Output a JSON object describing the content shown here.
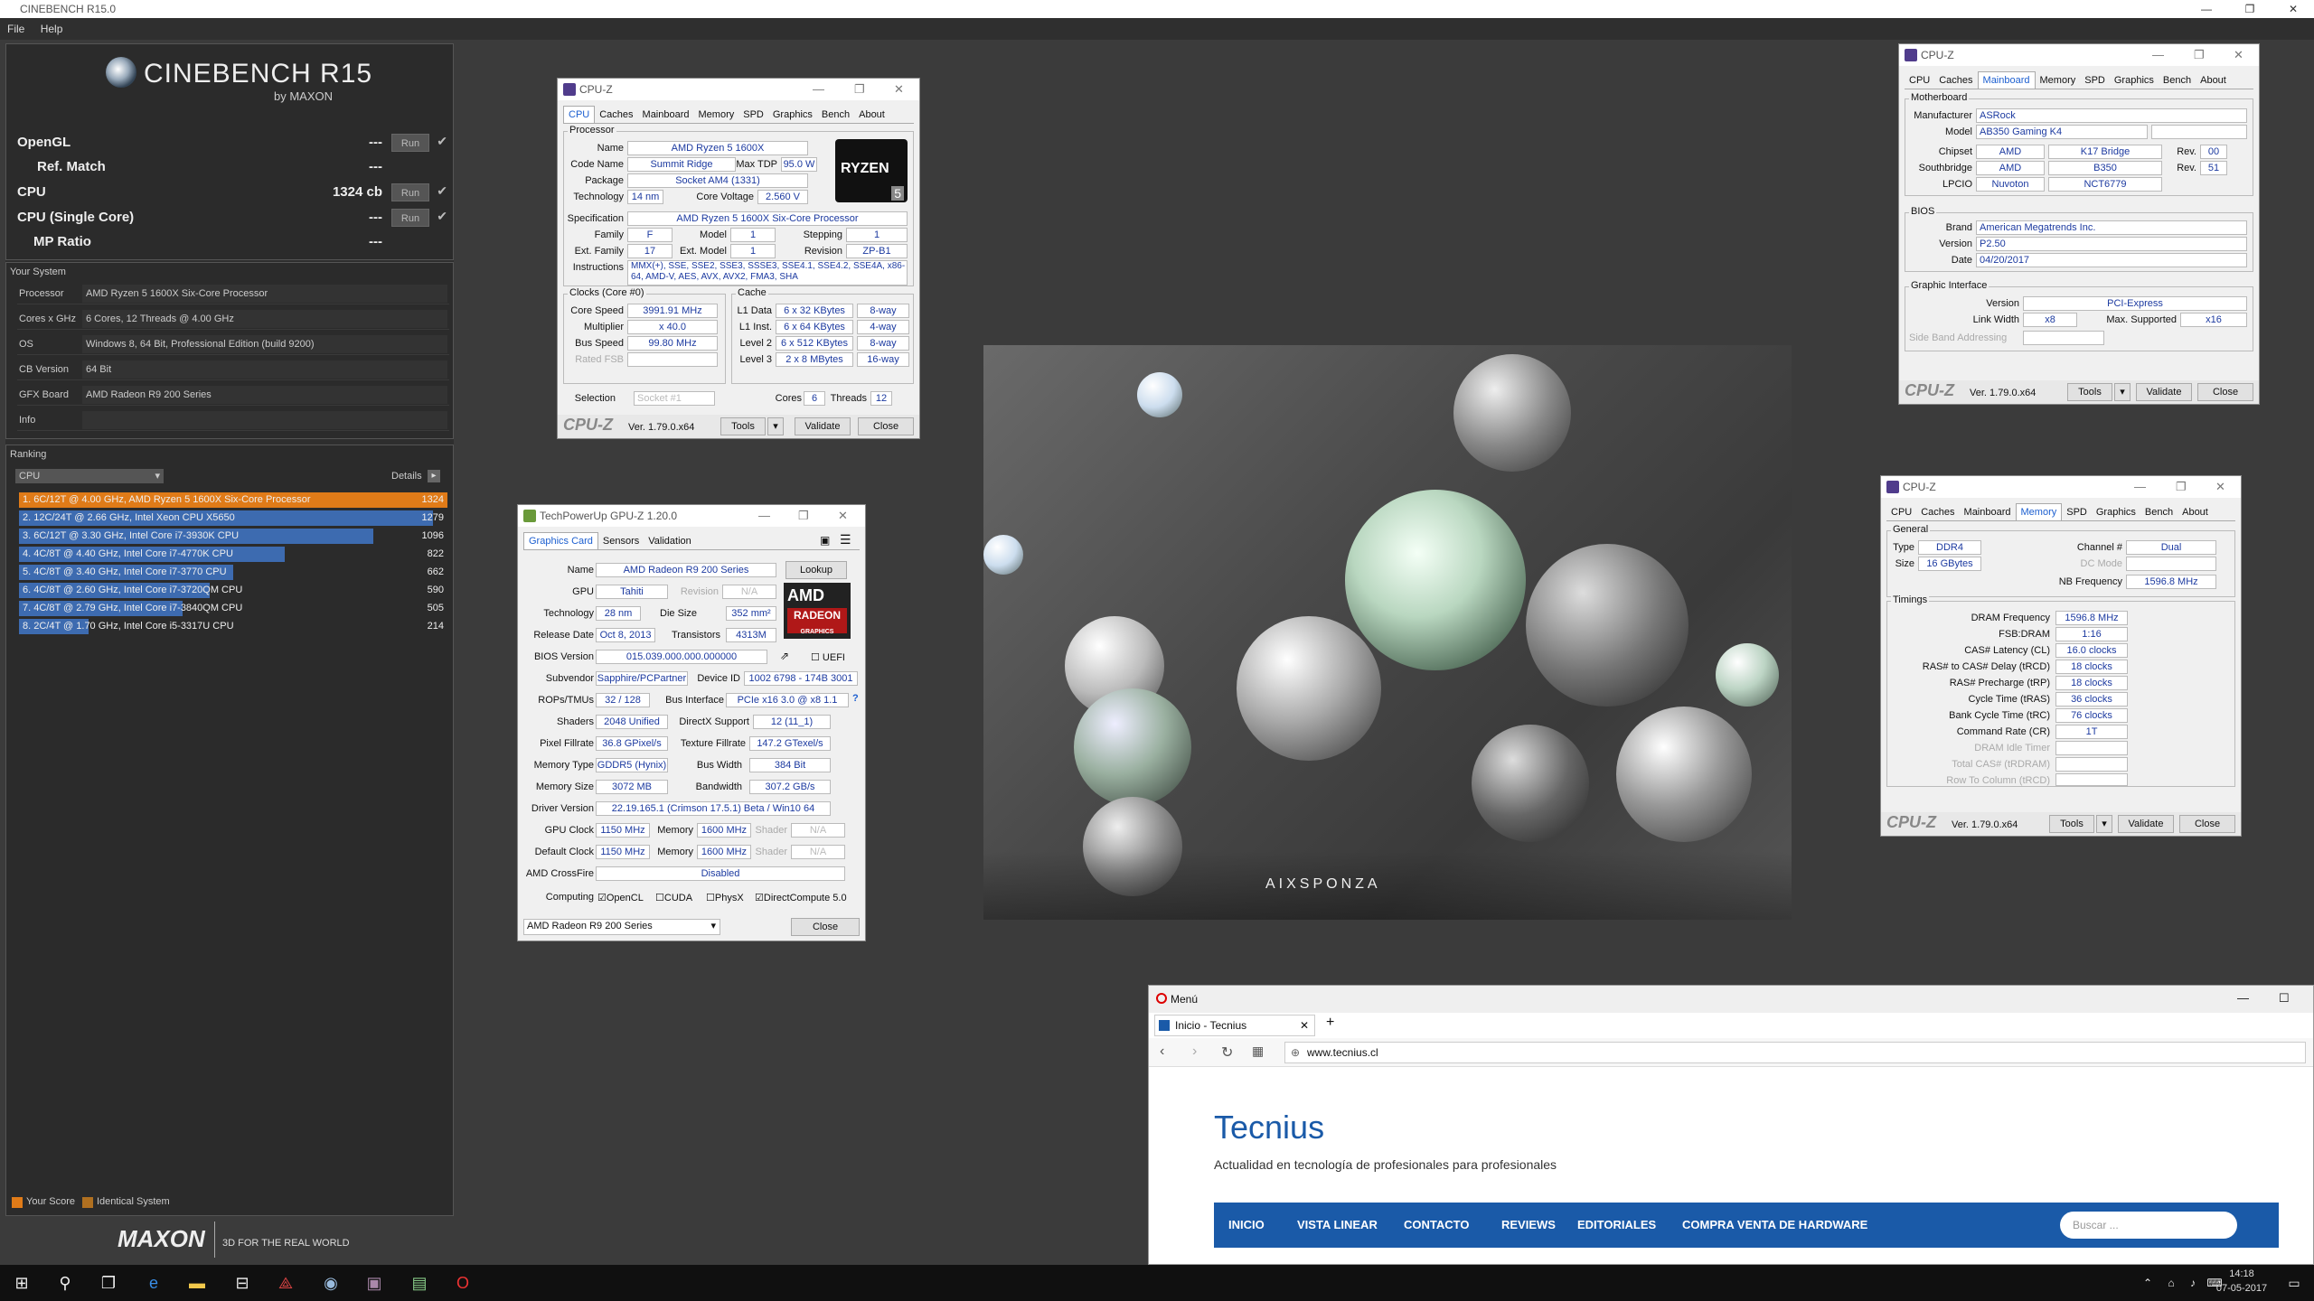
{
  "app": {
    "title": "CINEBENCH R15.0",
    "menu": [
      "File",
      "Help"
    ],
    "window_controls": [
      "—",
      "❐",
      "✕"
    ]
  },
  "logo": {
    "name": "CINEBENCH R15",
    "by": "by MAXON"
  },
  "benchmarks": [
    {
      "label": "OpenGL",
      "value": "---",
      "run": "Run",
      "check": "✔"
    },
    {
      "label": "Ref. Match",
      "value": "---"
    },
    {
      "label": "CPU",
      "value": "1324 cb",
      "run": "Run",
      "check": "✔"
    },
    {
      "label": "CPU (Single Core)",
      "value": "---",
      "run": "Run",
      "check": "✔"
    },
    {
      "label": "MP Ratio",
      "value": "---"
    }
  ],
  "system": {
    "heading": "Your System",
    "rows": [
      {
        "k": "Processor",
        "v": "AMD Ryzen 5 1600X Six-Core Processor"
      },
      {
        "k": "Cores x GHz",
        "v": "6 Cores, 12 Threads @ 4.00 GHz"
      },
      {
        "k": "OS",
        "v": "Windows 8, 64 Bit, Professional Edition (build 9200)"
      },
      {
        "k": "CB Version",
        "v": "64 Bit"
      },
      {
        "k": "GFX Board",
        "v": "AMD Radeon R9 200 Series"
      },
      {
        "k": "Info",
        "v": ""
      }
    ]
  },
  "ranking": {
    "heading": "Ranking",
    "select": "CPU",
    "details": "Details",
    "items": [
      {
        "text": "1. 6C/12T @ 4.00 GHz, AMD Ryzen 5 1600X Six-Core Processor",
        "score": "1324",
        "fraction": 1.0,
        "color": "#e07b18"
      },
      {
        "text": "2. 12C/24T @ 2.66 GHz, Intel Xeon CPU X5650",
        "score": "1279",
        "fraction": 0.966,
        "color": "#3d6bb0"
      },
      {
        "text": "3. 6C/12T @ 3.30 GHz,  Intel Core i7-3930K CPU",
        "score": "1096",
        "fraction": 0.828,
        "color": "#3d6bb0"
      },
      {
        "text": "4. 4C/8T @ 4.40 GHz, Intel Core i7-4770K CPU",
        "score": "822",
        "fraction": 0.621,
        "color": "#3d6bb0"
      },
      {
        "text": "5. 4C/8T @ 3.40 GHz,  Intel Core i7-3770 CPU",
        "score": "662",
        "fraction": 0.5,
        "color": "#3d6bb0"
      },
      {
        "text": "6. 4C/8T @ 2.60 GHz, Intel Core i7-3720QM CPU",
        "score": "590",
        "fraction": 0.446,
        "color": "#3d6bb0"
      },
      {
        "text": "7. 4C/8T @ 2.79 GHz,  Intel Core i7-3840QM CPU",
        "score": "505",
        "fraction": 0.381,
        "color": "#3d6bb0"
      },
      {
        "text": "8. 2C/4T @ 1.70 GHz,  Intel Core i5-3317U CPU",
        "score": "214",
        "fraction": 0.162,
        "color": "#3d6bb0"
      }
    ],
    "legend": [
      "Your Score",
      "Identical System"
    ]
  },
  "footer": {
    "brand": "MAXON",
    "tagline": "3D FOR THE REAL WORLD"
  },
  "cpuz_cpu": {
    "title": "CPU-Z",
    "tabs": [
      "CPU",
      "Caches",
      "Mainboard",
      "Memory",
      "SPD",
      "Graphics",
      "Bench",
      "About"
    ],
    "processor": "Processor",
    "name": "AMD Ryzen 5 1600X",
    "code_name": "Summit Ridge",
    "max_tdp": "95.0 W",
    "package": "Socket AM4 (1331)",
    "technology": "14 nm",
    "core_voltage": "2.560 V",
    "specification": "AMD Ryzen 5 1600X Six-Core Processor",
    "family": "F",
    "model": "1",
    "stepping": "1",
    "ext_family": "17",
    "ext_model": "1",
    "revision": "ZP-B1",
    "instructions": "MMX(+), SSE, SSE2, SSE3, SSSE3, SSE4.1, SSE4.2, SSE4A, x86-64, AMD-V, AES, AVX, AVX2, FMA3, SHA",
    "clocks": "Clocks (Core #0)",
    "core_speed": "3991.91 MHz",
    "multiplier": "x 40.0",
    "bus_speed": "99.80 MHz",
    "rated_fsb": "Rated FSB",
    "cache": "Cache",
    "l1d": "6 x 32 KBytes",
    "l1d_w": "8-way",
    "l1i": "6 x 64 KBytes",
    "l1i_w": "4-way",
    "l2": "6 x 512 KBytes",
    "l2_w": "8-way",
    "l3": "2 x 8 MBytes",
    "l3_w": "16-way",
    "selection": "Socket #1",
    "cores": "6",
    "threads": "12",
    "brand": "CPU-Z",
    "version": "Ver. 1.79.0.x64",
    "tools": "Tools",
    "validate": "Validate",
    "close": "Close",
    "logo": "RYZEN",
    "logo_num": "5",
    "labels": {
      "name": "Name",
      "code": "Code Name",
      "tdp": "Max TDP",
      "pkg": "Package",
      "tech": "Technology",
      "cv": "Core Voltage",
      "spec": "Specification",
      "fam": "Family",
      "mod": "Model",
      "step": "Stepping",
      "efam": "Ext. Family",
      "emod": "Ext. Model",
      "rev": "Revision",
      "instr": "Instructions",
      "cs": "Core Speed",
      "mul": "Multiplier",
      "bus": "Bus Speed",
      "l1d": "L1 Data",
      "l1i": "L1 Inst.",
      "l2": "Level 2",
      "l3": "Level 3",
      "sel": "Selection",
      "cores": "Cores",
      "threads": "Threads"
    }
  },
  "gpuz": {
    "title": "TechPowerUp GPU-Z 1.20.0",
    "tabs": [
      "Graphics Card",
      "Sensors",
      "Validation"
    ],
    "name": "AMD Radeon R9 200 Series",
    "lookup": "Lookup",
    "gpu": "Tahiti",
    "revision": "N/A",
    "technology": "28 nm",
    "die_size": "352 mm²",
    "release": "Oct 8, 2013",
    "transistors": "4313M",
    "bios": "015.039.000.000.000000",
    "uefi": "UEFI",
    "subvendor": "Sapphire/PCPartner",
    "device_id": "1002 6798 - 174B 3001",
    "rops": "32 / 128",
    "bus_if": "PCIe x16 3.0 @ x8 1.1",
    "shaders": "2048 Unified",
    "directx": "12 (11_1)",
    "pixel": "36.8 GPixel/s",
    "texture": "147.2 GTexel/s",
    "mem_type": "GDDR5 (Hynix)",
    "bus_width": "384 Bit",
    "mem_size": "3072 MB",
    "bandwidth": "307.2 GB/s",
    "driver": "22.19.165.1 (Crimson 17.5.1) Beta / Win10 64",
    "gpu_clock": "1150 MHz",
    "mem1": "1600 MHz",
    "def_clock": "1150 MHz",
    "mem2": "1600 MHz",
    "shader": "N/A",
    "crossfire": "Disabled",
    "computing": [
      "OpenCL",
      "CUDA",
      "PhysX",
      "DirectCompute 5.0"
    ],
    "select": "AMD Radeon R9 200 Series",
    "close": "Close",
    "logo": "AMD",
    "logo2": "RADEON",
    "logo3": "GRAPHICS",
    "labels": {
      "name": "Name",
      "gpu": "GPU",
      "rev": "Revision",
      "tech": "Technology",
      "die": "Die Size",
      "rel": "Release Date",
      "trans": "Transistors",
      "bios": "BIOS Version",
      "sub": "Subvendor",
      "dev": "Device ID",
      "rops": "ROPs/TMUs",
      "busif": "Bus Interface",
      "sh": "Shaders",
      "dx": "DirectX Support",
      "pix": "Pixel Fillrate",
      "tex": "Texture Fillrate",
      "mt": "Memory Type",
      "bw": "Bus Width",
      "ms": "Memory Size",
      "band": "Bandwidth",
      "drv": "Driver Version",
      "gc": "GPU Clock",
      "mem": "Memory",
      "shd": "Shader",
      "dc": "Default Clock",
      "cf": "AMD CrossFire",
      "comp": "Computing"
    }
  },
  "cpuz_mb": {
    "title": "CPU-Z",
    "tabs": [
      "CPU",
      "Caches",
      "Mainboard",
      "Memory",
      "SPD",
      "Graphics",
      "Bench",
      "About"
    ],
    "motherboard": "Motherboard",
    "manufacturer": "ASRock",
    "model": "AB350 Gaming K4",
    "chipset": "AMD",
    "chipset2": "K17 Bridge",
    "chip_rev": "00",
    "southbridge": "AMD",
    "southbridge2": "B350",
    "sb_rev": "51",
    "lpcio": "Nuvoton",
    "lpcio2": "NCT6779",
    "bios": "BIOS",
    "brand": "American Megatrends Inc.",
    "version": "P2.50",
    "date": "04/20/2017",
    "gi": "Graphic Interface",
    "gi_version": "PCI-Express",
    "link_width": "x8",
    "max_supported": "x16",
    "side_band": "Side Band Addressing",
    "cpuz": "CPU-Z",
    "ver": "Ver. 1.79.0.x64",
    "tools": "Tools",
    "validate": "Validate",
    "close": "Close",
    "labels": {
      "man": "Manufacturer",
      "mod": "Model",
      "chip": "Chipset",
      "rev": "Rev.",
      "sb": "Southbridge",
      "lpc": "LPCIO",
      "br": "Brand",
      "ver": "Version",
      "date": "Date",
      "v": "Version",
      "lw": "Link Width",
      "ms": "Max. Supported"
    }
  },
  "cpuz_mem": {
    "title": "CPU-Z",
    "tabs": [
      "CPU",
      "Caches",
      "Mainboard",
      "Memory",
      "SPD",
      "Graphics",
      "Bench",
      "About"
    ],
    "general": "General",
    "type": "DDR4",
    "size": "16 GBytes",
    "channel": "Dual",
    "dc_mode": "DC Mode",
    "nb_freq": "1596.8 MHz",
    "timings": "Timings",
    "dram_freq": "1596.8 MHz",
    "fsb_dram": "1:16",
    "cas": "16.0 clocks",
    "rcd": "18 clocks",
    "rp": "18 clocks",
    "ras": "36 clocks",
    "rc": "76 clocks",
    "cr": "1T",
    "cpuz": "CPU-Z",
    "ver": "Ver. 1.79.0.x64",
    "tools": "Tools",
    "validate": "Validate",
    "close": "Close",
    "labels": {
      "type": "Type",
      "size": "Size",
      "ch": "Channel #",
      "nb": "NB Frequency",
      "df": "DRAM Frequency",
      "fsb": "FSB:DRAM",
      "cas": "CAS# Latency (CL)",
      "rcd": "RAS# to CAS# Delay (tRCD)",
      "rp": "RAS# Precharge (tRP)",
      "ras": "Cycle Time (tRAS)",
      "rc": "Bank Cycle Time (tRC)",
      "cr": "Command Rate (CR)",
      "idle": "DRAM Idle Timer",
      "trdram": "Total CAS# (tRDRAM)",
      "trcd": "Row To Column (tRCD)"
    }
  },
  "render": {
    "brand": "AIXSPONZA"
  },
  "browser": {
    "menu": "Menú",
    "tab": "Inicio - Tecnius",
    "new_tab": "+",
    "url": "www.tecnius.cl",
    "site_title": "Tecnius",
    "site_sub": "Actualidad en tecnología de profesionales para profesionales",
    "nav": [
      "INICIO",
      "VISTA LINEAR",
      "CONTACTO",
      "REVIEWS",
      "EDITORIALES",
      "COMPRA VENTA DE HARDWARE"
    ],
    "search": "Buscar ..."
  },
  "taskbar": {
    "time": "14:18",
    "date": "07-05-2017"
  },
  "colors": {
    "accent": "#e07b18",
    "bar": "#3d6bb0",
    "cpuz_value": "#1c3aa0",
    "tecnius_nav": "#1a5aa8"
  }
}
